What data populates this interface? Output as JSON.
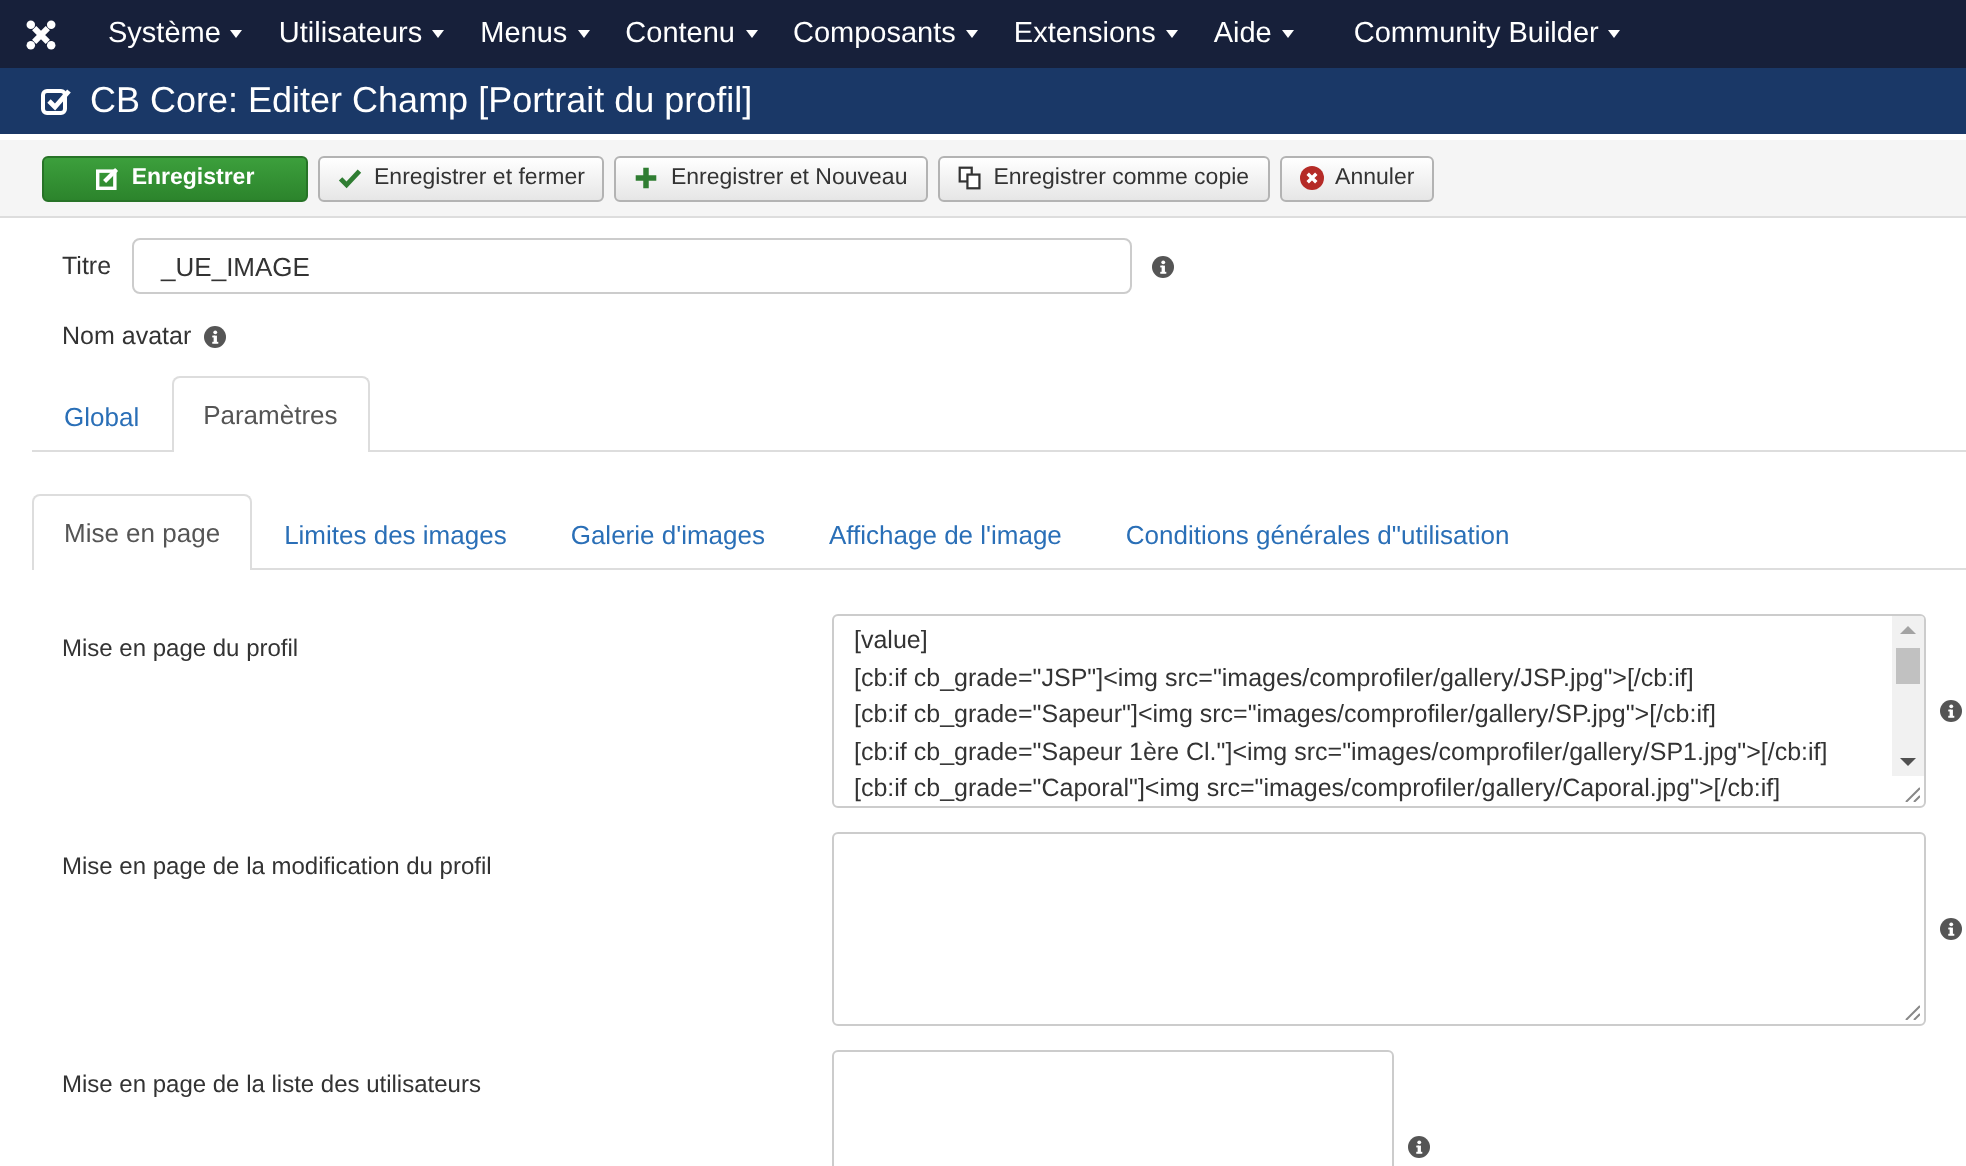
{
  "menu": [
    {
      "label": "Système"
    },
    {
      "label": "Utilisateurs"
    },
    {
      "label": "Menus"
    },
    {
      "label": "Contenu"
    },
    {
      "label": "Composants"
    },
    {
      "label": "Extensions"
    },
    {
      "label": "Aide"
    },
    {
      "label": "Community Builder"
    }
  ],
  "header": {
    "title": "CB Core: Editer Champ [Portrait du profil]"
  },
  "toolbar": [
    {
      "label": "Enregistrer",
      "kind": "save"
    },
    {
      "label": "Enregistrer et fermer",
      "kind": "check"
    },
    {
      "label": "Enregistrer et Nouveau",
      "kind": "plus"
    },
    {
      "label": "Enregistrer comme copie",
      "kind": "copy"
    },
    {
      "label": "Annuler",
      "kind": "cancel"
    }
  ],
  "title_field": {
    "label": "Titre",
    "value": "_UE_IMAGE"
  },
  "avatar_label": "Nom avatar",
  "tabs": [
    {
      "label": "Global",
      "selected": false
    },
    {
      "label": "Paramètres",
      "selected": true
    }
  ],
  "subtabs": [
    {
      "label": "Mise en page",
      "selected": true
    },
    {
      "label": "Limites des images",
      "selected": false
    },
    {
      "label": "Galerie d'images",
      "selected": false
    },
    {
      "label": "Affichage de l'image",
      "selected": false
    },
    {
      "label": "Conditions générales d\"utilisation",
      "selected": false
    }
  ],
  "fields": [
    {
      "label": "Mise en page du profil",
      "lines": [
        "[value]",
        "[cb:if cb_grade=\"JSP\"]<img src=\"images/comprofiler/gallery/JSP.jpg\">[/cb:if]",
        "[cb:if cb_grade=\"Sapeur\"]<img src=\"images/comprofiler/gallery/SP.jpg\">[/cb:if]",
        "[cb:if cb_grade=\"Sapeur 1ère Cl.\"]<img src=\"images/comprofiler/gallery/SP1.jpg\">[/cb:if]",
        "[cb:if cb_grade=\"Caporal\"]<img src=\"images/comprofiler/gallery/Caporal.jpg\">[/cb:if]"
      ]
    },
    {
      "label": "Mise en page de la modification du profil"
    },
    {
      "label": "Mise en page de la liste des utilisateurs"
    }
  ]
}
